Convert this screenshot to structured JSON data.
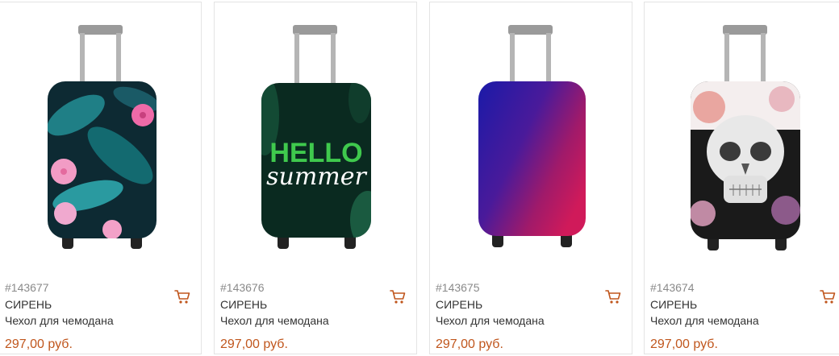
{
  "products": [
    {
      "sku": "#143677",
      "brand": "СИРЕНЬ",
      "name": "Чехол для чемодана",
      "price": "297,00 руб.",
      "cart_icon": "cart-icon",
      "image": "tropical-flowers-suitcase-cover"
    },
    {
      "sku": "#143676",
      "brand": "СИРЕНЬ",
      "name": "Чехол для чемодана",
      "price": "297,00 руб.",
      "cart_icon": "cart-icon",
      "image": "hello-summer-suitcase-cover",
      "image_text": {
        "line1": "HELLO",
        "line2": "summer"
      }
    },
    {
      "sku": "#143675",
      "brand": "СИРЕНЬ",
      "name": "Чехол для чемодана",
      "price": "297,00 руб.",
      "cart_icon": "cart-icon",
      "image": "gradient-suitcase-cover"
    },
    {
      "sku": "#143674",
      "brand": "СИРЕНЬ",
      "name": "Чехол для чемодана",
      "price": "297,00 руб.",
      "cart_icon": "cart-icon",
      "image": "skull-flowers-suitcase-cover"
    }
  ],
  "colors": {
    "price": "#c0561d",
    "sku": "#8a8a8a",
    "text": "#333333",
    "border": "#e4e4e4"
  }
}
